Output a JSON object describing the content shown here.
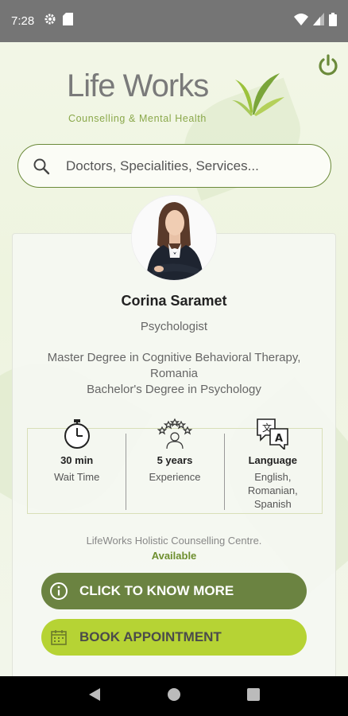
{
  "status_bar": {
    "time": "7:28",
    "left_icons": [
      "gear-icon",
      "sd-card-icon"
    ],
    "right_icons": [
      "wifi-icon",
      "cellular-icon",
      "battery-icon"
    ]
  },
  "logo": {
    "title": "Life Works",
    "subtitle": "Counselling & Mental Health"
  },
  "search": {
    "placeholder": "Doctors, Specialities, Services..."
  },
  "doctor": {
    "name": "Corina Saramet",
    "specialty": "Psychologist",
    "education_line1": "Master Degree in Cognitive Behavioral Therapy,",
    "education_line2": "Romania",
    "education_line3": "Bachelor's Degree in Psychology"
  },
  "stats": [
    {
      "icon": "stopwatch-icon",
      "value": "30 min",
      "label": "Wait Time"
    },
    {
      "icon": "experience-stars-icon",
      "value": "5 years",
      "label": "Experience"
    },
    {
      "icon": "translate-icon",
      "value": "Language",
      "label1": "English,",
      "label2": "Romanian,",
      "label3": "Spanish"
    }
  ],
  "centre": {
    "name": "LifeWorks Holistic Counselling Centre.",
    "availability": "Available"
  },
  "buttons": {
    "more": "CLICK TO KNOW MORE",
    "book": "BOOK APPOINTMENT"
  },
  "colors": {
    "accent_dark": "#6b8341",
    "accent_light": "#b6d334",
    "status_bar": "#757575"
  }
}
